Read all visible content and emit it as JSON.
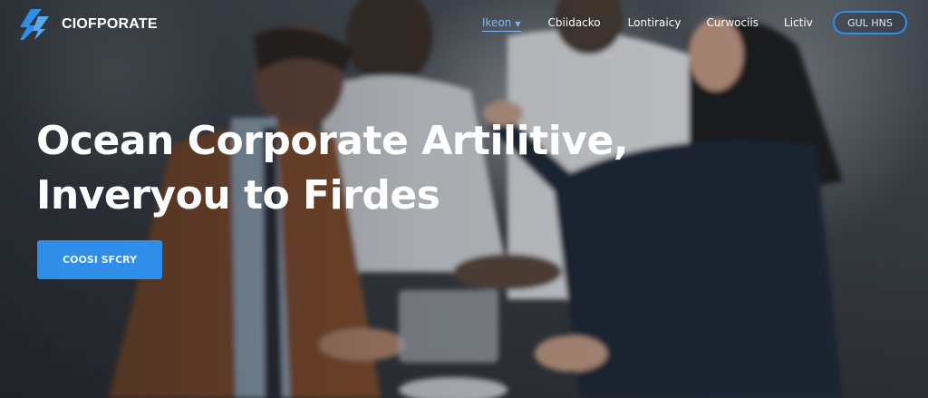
{
  "brand": {
    "name": "CIOFPORATE",
    "logo_icon": "lightning-bolt-icon",
    "accent": "#2f8ee8"
  },
  "nav": {
    "items": [
      {
        "label": "Ikeon",
        "active": true,
        "has_dropdown": true
      },
      {
        "label": "Cbiidacko"
      },
      {
        "label": "Lontiraicy"
      },
      {
        "label": "Curwociis"
      },
      {
        "label": "Lictiv"
      }
    ],
    "cta_label": "GUL HNS"
  },
  "hero": {
    "headline_line1": "Ocean Corporate Artilitive,",
    "headline_line2": "Inveryou to Firdes",
    "button_label": "COOSI SFCRY"
  }
}
